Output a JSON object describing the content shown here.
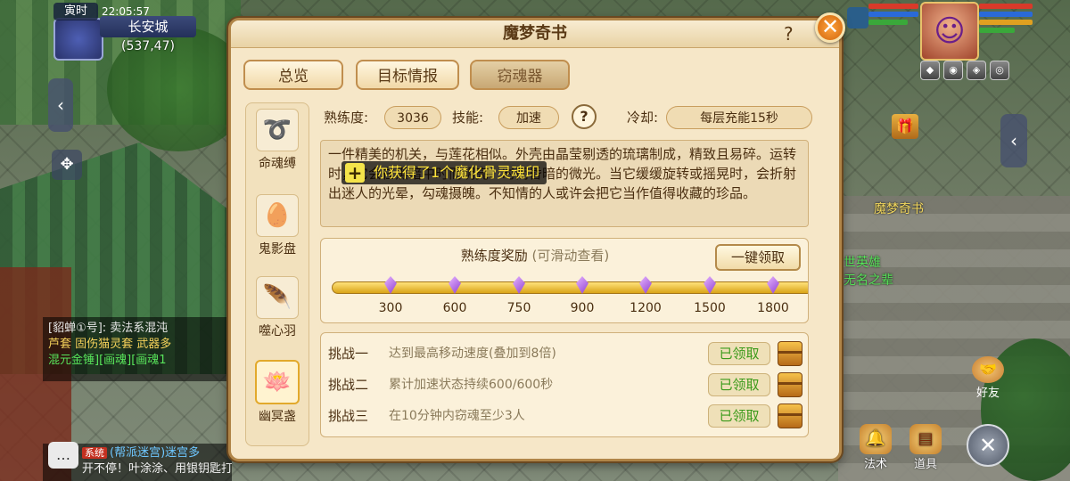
{
  "hud": {
    "time_label": "寅时",
    "clock": "22:05:57",
    "city": "长安城",
    "coords": "(537,47)"
  },
  "chat": {
    "line1": "[貂蝉①号]: 卖法系混沌",
    "line2": "芦套 固伤猫灵套 武器多",
    "line3": "混元金锤][画魂][画魂1",
    "system_tag": "系统",
    "bottom1": "(帮派迷宫)迷宫多",
    "bottom2": "开不停！叶涂涂、用银钥匙打开了"
  },
  "right_hud": {
    "npc_name": "魔梦奇书",
    "npc_title1": "世英雄",
    "npc_title2": "无名之辈",
    "friend_label": "好友",
    "skill_label": "法术",
    "item_label": "道具"
  },
  "dialog": {
    "title": "魔梦奇书",
    "help": "?",
    "close": "✕",
    "tabs": [
      {
        "label": "总览",
        "active": false
      },
      {
        "label": "目标情报",
        "active": false
      },
      {
        "label": "窃魂器",
        "active": true
      }
    ],
    "side_items": [
      {
        "label": "命魂缚",
        "icon": "rope-icon",
        "glyph": "➰",
        "selected": false
      },
      {
        "label": "鬼影盘",
        "icon": "red-disc-icon",
        "glyph": "🥚",
        "selected": false
      },
      {
        "label": "噬心羽",
        "icon": "feather-icon",
        "glyph": "🪶",
        "selected": false
      },
      {
        "label": "幽冥盏",
        "icon": "lotus-lamp-icon",
        "glyph": "🪷",
        "selected": true
      }
    ],
    "stats": {
      "proficiency_label": "熟练度:",
      "proficiency_value": "3036",
      "skill_label": "技能:",
      "skill_value": "加速",
      "cooldown_label": "冷却:",
      "cooldown_value": "每层充能15秒"
    },
    "description": "一件精美的机关，与莲花相似。外壳由晶莹剔透的琉璃制成，精致且易碎。运转时，它会在黑暗中时而明亮、时而昏暗的微光。当它缓缓旋转或摇晃时，会折射出迷人的光晕，勾魂摄魄。不知情的人或许会把它当作值得收藏的珍品。",
    "toast": "你获得了1个魔化骨灵魂印",
    "reward": {
      "title": "熟练度奖励",
      "subtitle": "(可滑动查看)",
      "claim_all": "一键领取",
      "milestones": [
        "300",
        "600",
        "750",
        "900",
        "1200",
        "1500",
        "1800"
      ]
    },
    "challenges": [
      {
        "name": "挑战一",
        "desc": "达到最高移动速度(叠加到8倍)",
        "status": "已领取"
      },
      {
        "name": "挑战二",
        "desc": "累计加速状态持续600/600秒",
        "status": "已领取"
      },
      {
        "name": "挑战三",
        "desc": "在10分钟内窃魂至少3人",
        "status": "已领取"
      }
    ]
  }
}
